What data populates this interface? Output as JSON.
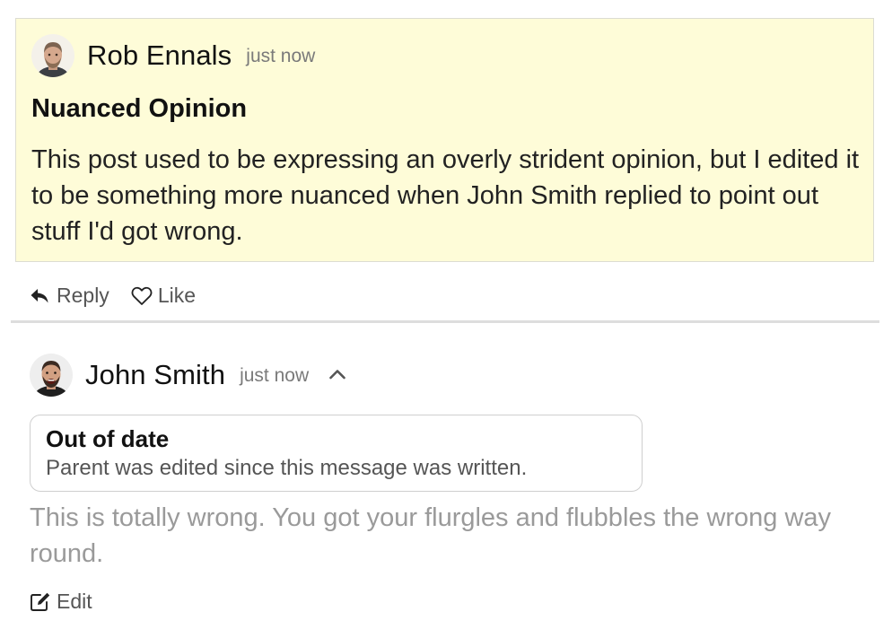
{
  "post": {
    "author": "Rob Ennals",
    "timestamp": "just now",
    "title": "Nuanced Opinion",
    "body": "This post used to be expressing an overly strident opinion, but I edited it to be something more nuanced when John Smith replied to point out stuff I'd got wrong.",
    "background_color": "#fefcd8",
    "actions": {
      "reply_label": "Reply",
      "like_label": "Like"
    }
  },
  "reply": {
    "author": "John Smith",
    "timestamp": "just now",
    "notice": {
      "title": "Out of date",
      "text": "Parent was edited since this message was written."
    },
    "body": "This is totally wrong. You got your flurgles and flubbles the wrong way round.",
    "actions": {
      "edit_label": "Edit"
    }
  },
  "icons": {
    "reply": "reply-arrow-icon",
    "like": "heart-outline-icon",
    "collapse": "chevron-up-icon",
    "edit": "edit-pencil-icon"
  }
}
